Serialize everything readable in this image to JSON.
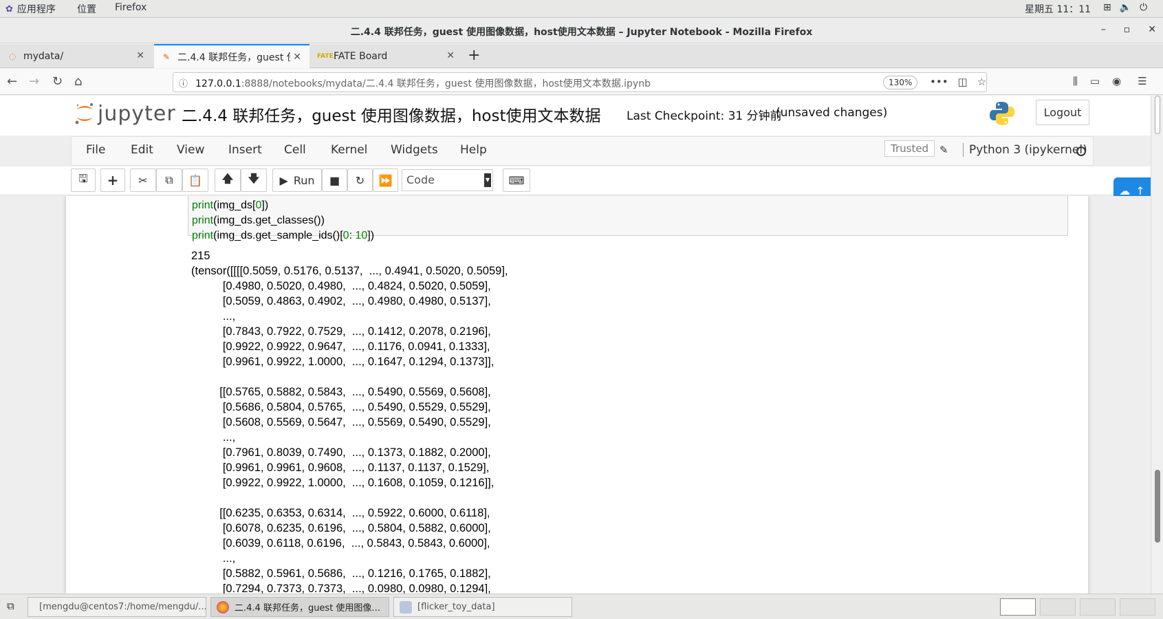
{
  "topbar": {
    "apps_label": "应用程序",
    "places_label": "位置",
    "firefox_label": "Firefox",
    "clock": "星期五 11：11"
  },
  "window": {
    "title": "二.4.4 联邦任务，guest 使用图像数据，host使用文本数据 – Jupyter Notebook - Mozilla Firefox"
  },
  "tabs": [
    {
      "label": "mydata/",
      "icon": "jupyter-icon"
    },
    {
      "label": "二.4.4 联邦任务，guest 使",
      "icon": "notebook-icon",
      "active": true
    },
    {
      "label": "FATE Board",
      "icon": "fate-icon"
    }
  ],
  "urlbar": {
    "host": "127.0.0.1",
    "path": ":8888/notebooks/mydata/二.4.4 联邦任务，guest 使用图像数据，host使用文本数据.ipynb",
    "zoom": "130%"
  },
  "jupyter": {
    "logo_text": "jupyter",
    "notebook_name": "二.4.4 联邦任务，guest 使用图像数据，host使用文本数据",
    "checkpoint": "Last Checkpoint: 31 分钟前",
    "unsaved": "(unsaved changes)",
    "logout": "Logout",
    "menu": [
      "File",
      "Edit",
      "View",
      "Insert",
      "Cell",
      "Kernel",
      "Widgets",
      "Help"
    ],
    "trusted": "Trusted",
    "kernel": "Python 3 (ipykernel)",
    "run_label": "Run",
    "cell_type": "Code"
  },
  "code_cell": {
    "lines": [
      {
        "fn": "print",
        "open": "(img_ds[",
        "num": "0",
        "close": "])"
      },
      {
        "fn": "print",
        "open": "(img_ds.get_classes())",
        "num": "",
        "close": ""
      },
      {
        "fn": "print",
        "open": "(img_ds.get_sample_ids()[",
        "num": "0",
        "mid": ": ",
        "num2": "10",
        "close": "])"
      }
    ]
  },
  "output": {
    "lines": [
      "215",
      "(tensor([[[[0.5059, 0.5176, 0.5137,  ..., 0.4941, 0.5020, 0.5059],",
      "          [0.4980, 0.5020, 0.4980,  ..., 0.4824, 0.5020, 0.5059],",
      "          [0.5059, 0.4863, 0.4902,  ..., 0.4980, 0.4980, 0.5137],",
      "          ...,",
      "          [0.7843, 0.7922, 0.7529,  ..., 0.1412, 0.2078, 0.2196],",
      "          [0.9922, 0.9922, 0.9647,  ..., 0.1176, 0.0941, 0.1333],",
      "          [0.9961, 0.9922, 1.0000,  ..., 0.1647, 0.1294, 0.1373]],",
      "",
      "         [[0.5765, 0.5882, 0.5843,  ..., 0.5490, 0.5569, 0.5608],",
      "          [0.5686, 0.5804, 0.5765,  ..., 0.5490, 0.5529, 0.5529],",
      "          [0.5608, 0.5569, 0.5647,  ..., 0.5569, 0.5490, 0.5529],",
      "          ...,",
      "          [0.7961, 0.8039, 0.7490,  ..., 0.1373, 0.1882, 0.2000],",
      "          [0.9961, 0.9961, 0.9608,  ..., 0.1137, 0.1137, 0.1529],",
      "          [0.9922, 0.9922, 1.0000,  ..., 0.1608, 0.1059, 0.1216]],",
      "",
      "         [[0.6235, 0.6353, 0.6314,  ..., 0.5922, 0.6000, 0.6118],",
      "          [0.6078, 0.6235, 0.6196,  ..., 0.5804, 0.5882, 0.6000],",
      "          [0.6039, 0.6118, 0.6196,  ..., 0.5843, 0.5843, 0.6000],",
      "          ...,",
      "          [0.5882, 0.5961, 0.5686,  ..., 0.1216, 0.1765, 0.1882],",
      "          [0.7294, 0.7373, 0.7373,  ..., 0.0980, 0.0980, 0.1294],"
    ]
  },
  "taskbar": {
    "items": [
      {
        "label": "[mengdu@centos7:/home/mengdu/...",
        "icon": "terminal-icon"
      },
      {
        "label": "二.4.4 联邦任务，guest 使用图像...",
        "icon": "firefox-icon",
        "active": true
      },
      {
        "label": "[flicker_toy_data]",
        "icon": "file-manager-icon"
      }
    ]
  },
  "colors": {
    "accent_blue": "#0a84ff",
    "jupyter_orange": "#f37726",
    "code_green": "#008000"
  }
}
